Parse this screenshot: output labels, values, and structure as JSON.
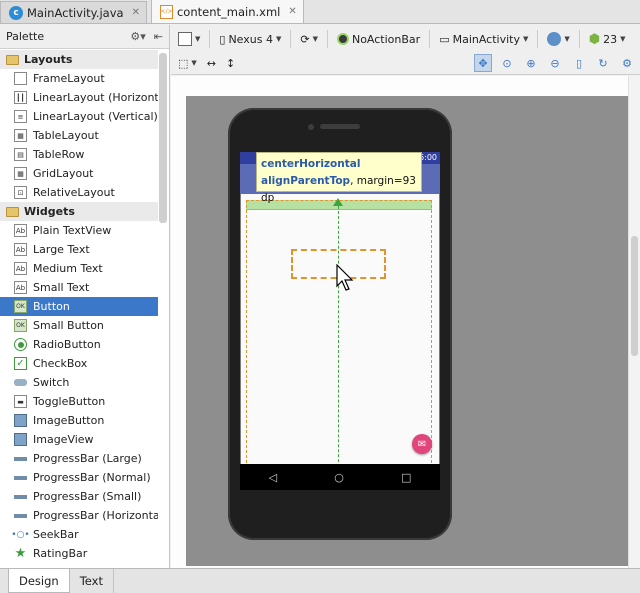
{
  "tabs": [
    {
      "label": "MainActivity.java",
      "icon": "java-class-icon",
      "active": false
    },
    {
      "label": "content_main.xml",
      "icon": "xml-file-icon",
      "active": true
    }
  ],
  "palette": {
    "title": "Palette",
    "categories": [
      {
        "label": "Layouts",
        "items": [
          "FrameLayout",
          "LinearLayout (Horizontal)",
          "LinearLayout (Vertical)",
          "TableLayout",
          "TableRow",
          "GridLayout",
          "RelativeLayout"
        ]
      },
      {
        "label": "Widgets",
        "items": [
          "Plain TextView",
          "Large Text",
          "Medium Text",
          "Small Text",
          "Button",
          "Small Button",
          "RadioButton",
          "CheckBox",
          "Switch",
          "ToggleButton",
          "ImageButton",
          "ImageView",
          "ProgressBar (Large)",
          "ProgressBar (Normal)",
          "ProgressBar (Small)",
          "ProgressBar (Horizontal)",
          "SeekBar",
          "RatingBar"
        ]
      }
    ],
    "selected": "Button"
  },
  "toolbar": {
    "device": "Nexus 4",
    "theme": "NoActionBar",
    "activity": "MainActivity",
    "api": "23"
  },
  "preview": {
    "status_time": "6:00",
    "tooltip_line1": "centerHorizontal",
    "tooltip_line2_kw": "alignParentTop",
    "tooltip_line2_rest": ", margin=93 dp"
  },
  "bottom_tabs": [
    {
      "label": "Design",
      "active": true
    },
    {
      "label": "Text",
      "active": false
    }
  ],
  "colors": {
    "selection": "#3b78c9",
    "status_bar": "#303f9f",
    "app_bar": "#5b6bb5",
    "fab": "#e0457b",
    "guide": "#3da53d",
    "drop_outline": "#e0952a"
  }
}
